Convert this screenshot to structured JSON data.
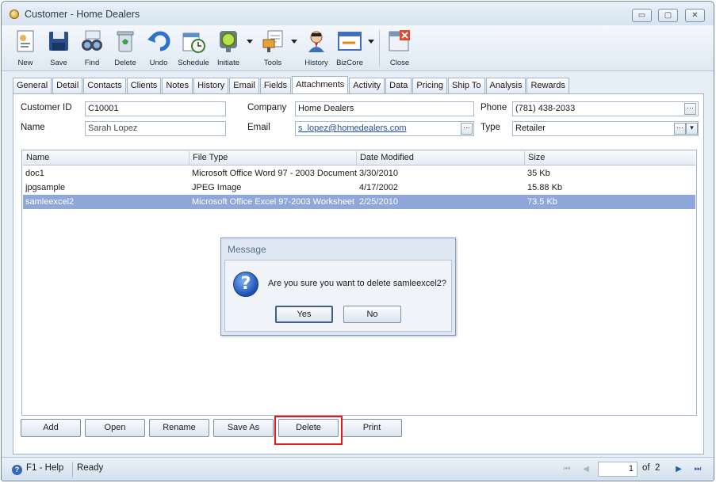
{
  "window": {
    "title": "Customer - Home Dealers",
    "controls": {
      "minimize": "▭",
      "maximize": "▢",
      "close": "✕"
    }
  },
  "toolbar": {
    "items": [
      {
        "label": "New",
        "icon": "new-icon"
      },
      {
        "label": "Save",
        "icon": "save-icon"
      },
      {
        "label": "Find",
        "icon": "find-icon"
      },
      {
        "label": "Delete",
        "icon": "delete-icon"
      },
      {
        "label": "Undo",
        "icon": "undo-icon"
      },
      {
        "label": "Schedule",
        "icon": "schedule-icon"
      },
      {
        "label": "Initiate",
        "icon": "initiate-icon"
      },
      {
        "label": "Tools",
        "icon": "tools-icon"
      },
      {
        "label": "History",
        "icon": "history-icon"
      },
      {
        "label": "BizCore",
        "icon": "bizcore-icon"
      },
      {
        "label": "Close",
        "icon": "close-icon"
      }
    ]
  },
  "tabs": [
    "General",
    "Detail",
    "Contacts",
    "Clients",
    "Notes",
    "History",
    "Email",
    "Fields",
    "Attachments",
    "Activity",
    "Data",
    "Pricing",
    "Ship To",
    "Analysis",
    "Rewards"
  ],
  "active_tab": "Attachments",
  "form": {
    "customer_id_label": "Customer ID",
    "customer_id": "C10001",
    "name_label": "Name",
    "name": "Sarah Lopez",
    "company_label": "Company",
    "company": "Home Dealers",
    "email_label": "Email",
    "email": "s_lopez@homedealers.com",
    "phone_label": "Phone",
    "phone": "(781) 438-2033",
    "type_label": "Type",
    "type": "Retailer",
    "ellipsis": "···",
    "dropdown": "▾"
  },
  "grid": {
    "columns": [
      "Name",
      "File Type",
      "Date Modified",
      "Size"
    ],
    "rows": [
      {
        "name": "doc1",
        "file_type": "Microsoft Office Word 97 - 2003 Document",
        "date": "3/30/2010",
        "size": "35 Kb",
        "selected": false
      },
      {
        "name": "jpgsample",
        "file_type": "JPEG Image",
        "date": "4/17/2002",
        "size": "15.88 Kb",
        "selected": false
      },
      {
        "name": "samleexcel2",
        "file_type": "Microsoft Office Excel 97-2003 Worksheet",
        "date": "2/25/2010",
        "size": "73.5 Kb",
        "selected": true
      }
    ]
  },
  "buttons": {
    "add": "Add",
    "open": "Open",
    "rename": "Rename",
    "save_as": "Save As",
    "delete": "Delete",
    "print": "Print"
  },
  "dialog": {
    "title": "Message",
    "message": "Are you sure you want to delete samleexcel2?",
    "yes": "Yes",
    "no": "No",
    "icon_glyph": "?"
  },
  "status": {
    "help": "F1 - Help",
    "state": "Ready",
    "help_glyph": "?",
    "page": "1",
    "of": "of",
    "total": "2",
    "first": "⏮",
    "prev": "◀",
    "next": "▶",
    "last": "⏭"
  },
  "colors": {
    "accent": "#8fa7d9",
    "highlight": "#e01a1a",
    "link": "#1f4fb0"
  }
}
